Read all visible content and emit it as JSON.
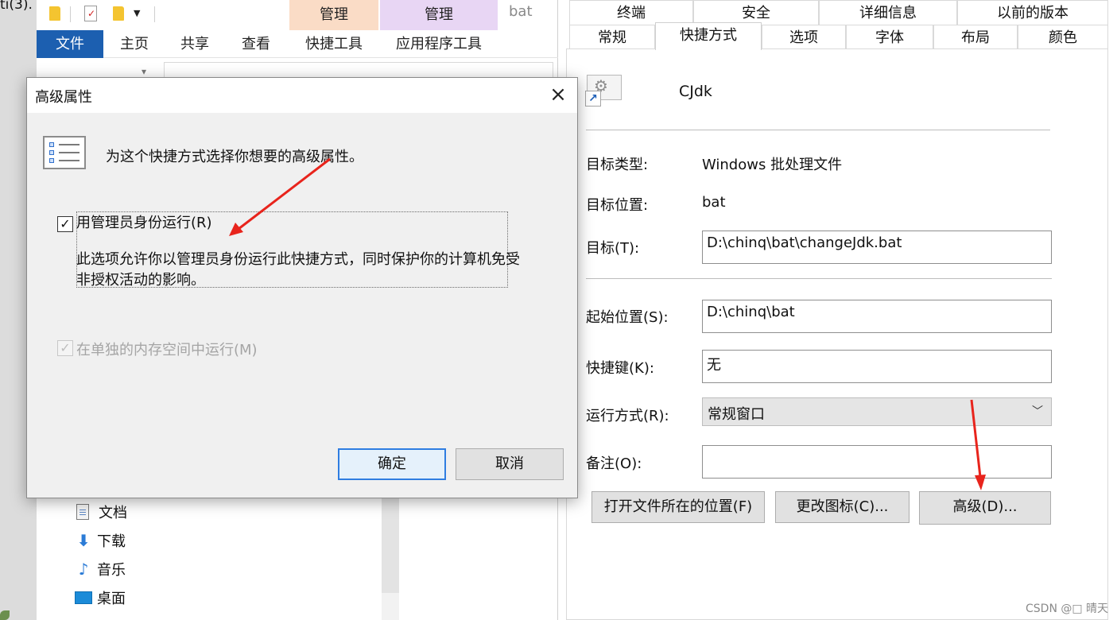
{
  "desktop": {
    "edge_text": "ti(3).",
    "icon": "leaf-icon"
  },
  "explorer": {
    "quick_access": {
      "icons": [
        "folder-icon",
        "properties-icon",
        "new-folder-icon",
        "dropdown-icon"
      ]
    },
    "context_headers": {
      "shortcut_tools": "管理",
      "app_tools": "管理",
      "folder_name": "bat"
    },
    "ribbon_tabs": [
      "文件",
      "主页",
      "共享",
      "查看",
      "快捷工具",
      "应用程序工具"
    ],
    "nav_items": [
      {
        "label": "文档",
        "icon": "document-icon"
      },
      {
        "label": "下载",
        "icon": "download-arrow-icon"
      },
      {
        "label": "音乐",
        "icon": "music-note-icon"
      },
      {
        "label": "桌面",
        "icon": "desktop-icon"
      }
    ],
    "colors": {
      "file_tab": "#1c5fb0",
      "shortcut_ctx": "#fadcc6",
      "app_ctx": "#e8d6f4"
    }
  },
  "properties": {
    "tabs_top": [
      "终端",
      "安全",
      "详细信息",
      "以前的版本"
    ],
    "tabs_bottom": [
      "常规",
      "快捷方式",
      "选项",
      "字体",
      "布局",
      "颜色"
    ],
    "active_tab": "快捷方式",
    "shortcut_name": "CJdk",
    "shortcut_icon": "batch-file-gear-icon",
    "fields": {
      "target_type_label": "目标类型:",
      "target_type_value": "Windows 批处理文件",
      "target_location_label": "目标位置:",
      "target_location_value": "bat",
      "target_label": "目标(T):",
      "target_value": "D:\\chinq\\bat\\changeJdk.bat",
      "start_in_label": "起始位置(S):",
      "start_in_value": "D:\\chinq\\bat",
      "hotkey_label": "快捷键(K):",
      "hotkey_value": "无",
      "run_label": "运行方式(R):",
      "run_value": "常规窗口",
      "comment_label": "备注(O):",
      "comment_value": ""
    },
    "buttons": {
      "open_location": "打开文件所在的位置(F)",
      "change_icon": "更改图标(C)...",
      "advanced": "高级(D)..."
    }
  },
  "advanced_dialog": {
    "title": "高级属性",
    "close": "×",
    "description": "为这个快捷方式选择你想要的高级属性。",
    "run_as_admin": {
      "label": "用管理员身份运行(R)",
      "checked": true,
      "description": "此选项允许你以管理员身份运行此快捷方式，同时保护你的计算机免受非授权活动的影响。"
    },
    "separate_memory": {
      "label": "在单独的内存空间中运行(M)",
      "checked": true,
      "enabled": false
    },
    "ok": "确定",
    "cancel": "取消",
    "accent": "#2f7de1"
  },
  "annotations": {
    "arrow_color": "#e8241c"
  },
  "watermark": "CSDN @□ 晴天"
}
